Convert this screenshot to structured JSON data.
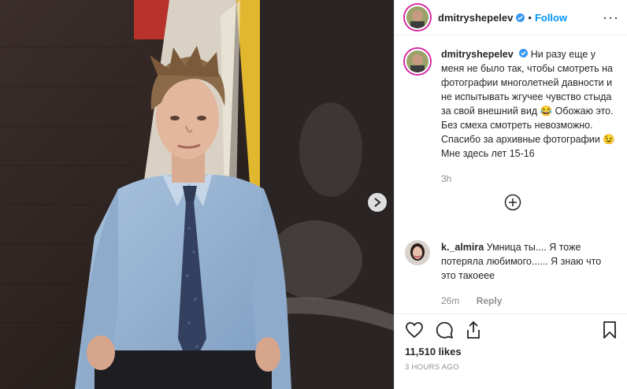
{
  "post": {
    "username": "dmitryshepelev",
    "follow_label": "Follow",
    "separator": "•",
    "more_label": "···"
  },
  "caption": {
    "username": "dmitryshepelev",
    "text": "Ни разу еще у меня не было так, чтобы смотреть на фотографии многолетней давности и не испытывать жгучее чувство стыда за свой внешний вид 😂 Обожаю это. Без смеха смотреть невозможно. Спасибо за архивные фотографии 😉 Мне здесь лет 15-16",
    "age": "3h"
  },
  "comment": {
    "username": "k._almira",
    "text": "Умница ты.... Я тоже потеряла любимого...... Я знаю что это такоеее",
    "age": "26m",
    "reply_label": "Reply"
  },
  "stats": {
    "likes": "11,510 likes",
    "posted": "3 HOURS AGO"
  },
  "colors": {
    "accent": "#0095f6",
    "verified": "#3897f0",
    "muted": "#8e8e8e"
  },
  "icons": [
    "next-arrow-icon",
    "verified-badge-icon",
    "more-options-icon",
    "plus-circle-icon",
    "heart-icon",
    "comment-icon",
    "share-icon",
    "bookmark-icon"
  ]
}
